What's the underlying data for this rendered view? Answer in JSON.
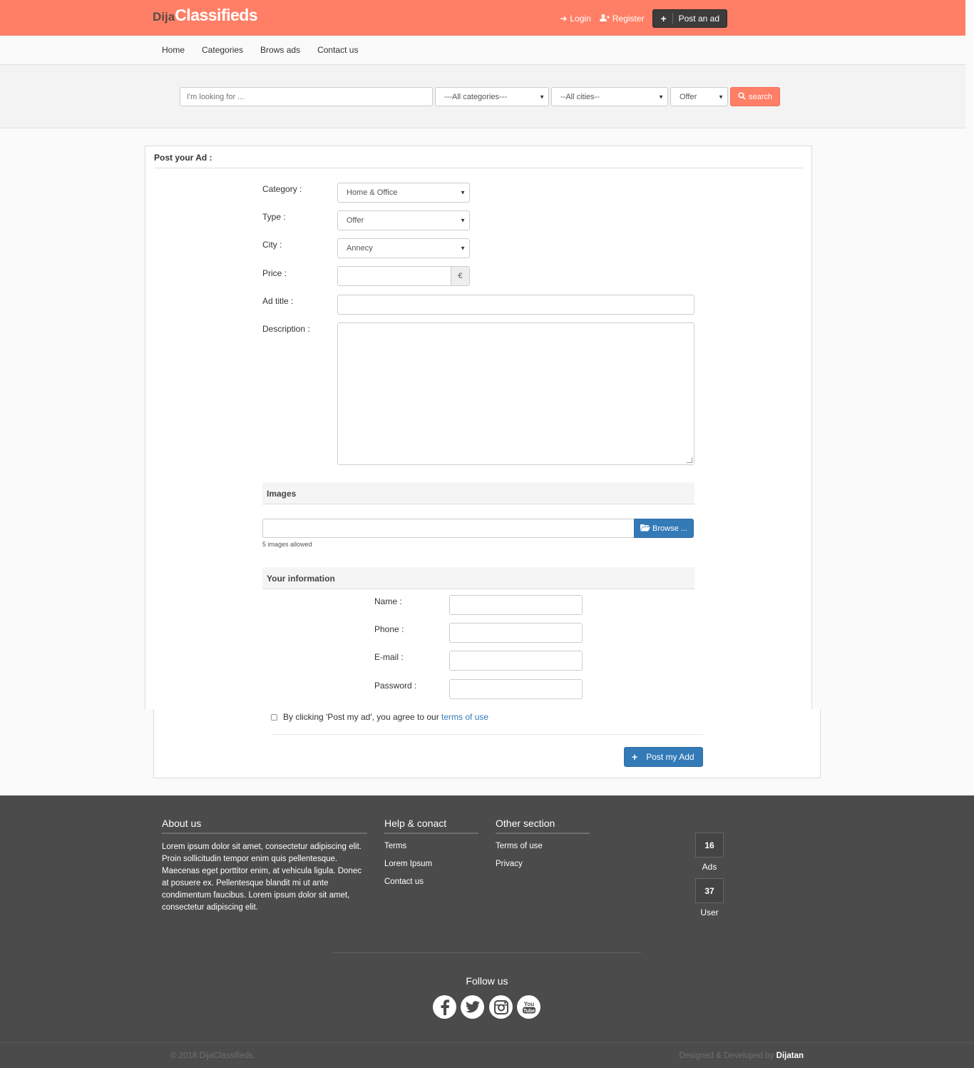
{
  "brand": {
    "part1": "Dija",
    "part2": "Classifieds"
  },
  "header": {
    "login": "Login",
    "register": "Register",
    "post_ad": "Post an ad"
  },
  "nav": {
    "items": [
      "Home",
      "Categories",
      "Brows ads",
      "Contact us"
    ]
  },
  "search": {
    "placeholder": "I'm looking for ...",
    "category": "---All categories---",
    "city": "--All cities--",
    "type": "Offer",
    "button": "search"
  },
  "form": {
    "title": "Post your Ad :",
    "category_label": "Category :",
    "category_value": "Home & Office",
    "type_label": "Type :",
    "type_value": "Offer",
    "city_label": "City :",
    "city_value": "Annecy",
    "price_label": "Price :",
    "currency": "€",
    "title_label": "Ad title :",
    "description_label": "Description :",
    "images_header": "Images",
    "browse_label": "Browse ...",
    "images_help": "5 images allowed",
    "info_header": "Your information",
    "name_label": "Name :",
    "phone_label": "Phone :",
    "email_label": "E-mail :",
    "password_label": "Password :",
    "agree_text": "By clicking 'Post my ad', you agree to our",
    "terms_link": "terms of use",
    "submit": "Post my Add"
  },
  "footer": {
    "about_title": "About us",
    "about_text": "Lorem ipsum dolor sit amet, consectetur adipiscing elit. Proin sollicitudin tempor enim quis pellentesque. Maecenas eget porttitor enim, at vehicula ligula. Donec at posuere ex. Pellentesque blandit mi ut ante condimentum faucibus. Lorem ipsum dolor sit amet, consectetur adipiscing elit.",
    "help_title": "Help & conact",
    "help_links": [
      "Terms",
      "Lorem Ipsum",
      "Contact us"
    ],
    "other_title": "Other section",
    "other_links": [
      "Terms of use",
      "Privacy"
    ],
    "stats": {
      "ads_count": "16",
      "ads_label": "Ads",
      "users_count": "37",
      "users_label": "User"
    },
    "follow": "Follow us",
    "copyright": "© 2018 DijaClassifieds.",
    "designed_by": "Designed & Developed by",
    "designer": "Dijatan"
  },
  "colors": {
    "brand": "#ff7f66",
    "primary": "#337ab7",
    "footer": "#4b4b4b"
  },
  "icons": [
    "sign-in-icon",
    "user-plus-icon",
    "plus-icon",
    "search-icon",
    "folder-open-icon",
    "facebook-icon",
    "twitter-icon",
    "instagram-icon",
    "youtube-icon"
  ]
}
